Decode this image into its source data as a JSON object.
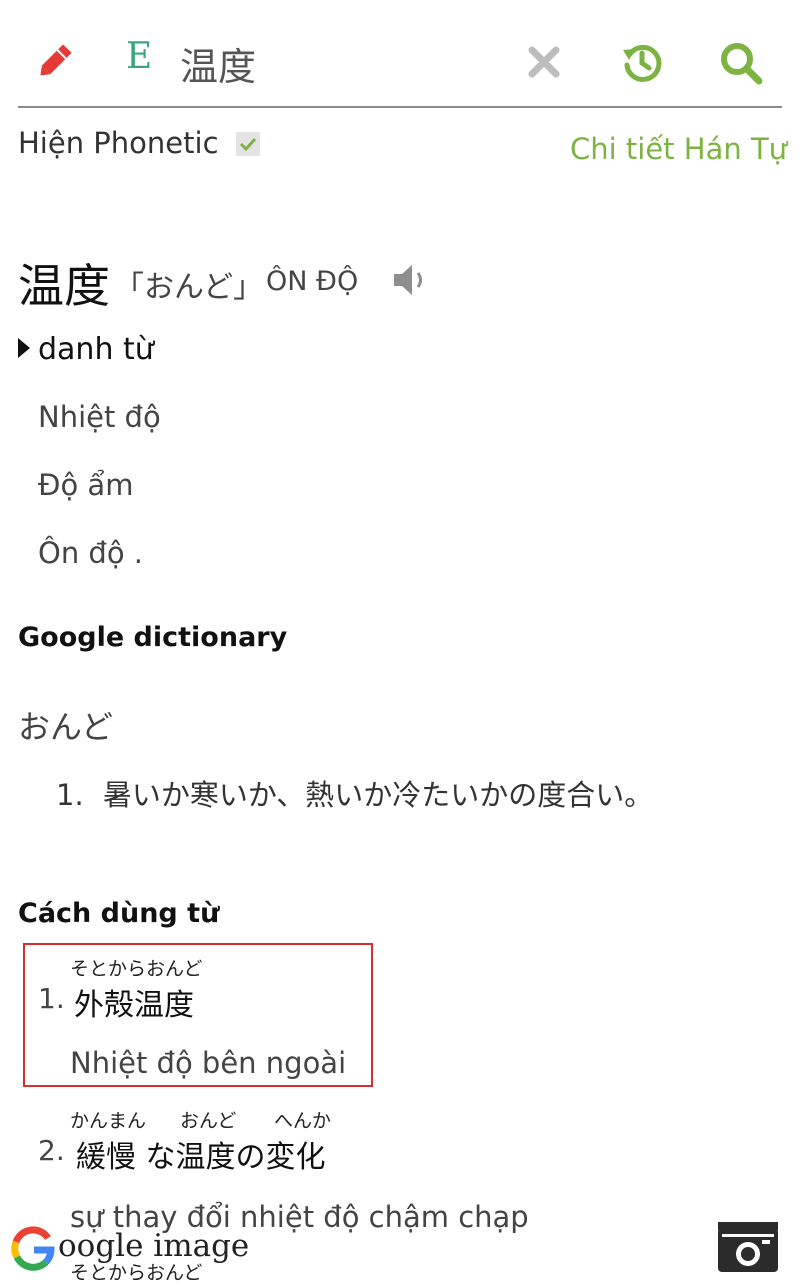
{
  "header": {
    "lang_letter": "E",
    "query": "温度",
    "icons": [
      "pencil-icon",
      "clear-icon",
      "history-icon",
      "search-icon"
    ],
    "accent_color": "#7cb342"
  },
  "options": {
    "phonetic_label": "Hiện Phonetic",
    "phonetic_checked": true,
    "detail_link": "Chi tiết Hán Tự"
  },
  "entry": {
    "word": "温度",
    "reading": "「おんど」",
    "hanviet": "ÔN ĐỘ",
    "pos": "danh từ",
    "meanings": [
      "Nhiệt độ",
      "Độ ẩm",
      "Ôn độ ."
    ]
  },
  "google_dict": {
    "title": "Google dictionary",
    "kana": "おんど",
    "definitions": [
      {
        "num": "1.",
        "text": "暑いか寒いか、熱いか冷たいかの度合い。"
      }
    ]
  },
  "usage": {
    "title": "Cách dùng từ",
    "examples": [
      {
        "num": "1.",
        "ruby": [
          "そとから",
          "おんど"
        ],
        "jp": "外殻温度",
        "vi": "Nhiệt độ bên ngoài"
      },
      {
        "num": "2.",
        "ruby": [
          "かんまん",
          "おんど",
          "へんか"
        ],
        "jp": "緩慢 な温度の変化",
        "vi": "sự thay đổi nhiệt độ chậm chạp"
      },
      {
        "ruby": [
          "そとからおんど"
        ]
      }
    ]
  },
  "footer": {
    "google_image": "oogle image",
    "camera_icon": "camera-icon"
  }
}
